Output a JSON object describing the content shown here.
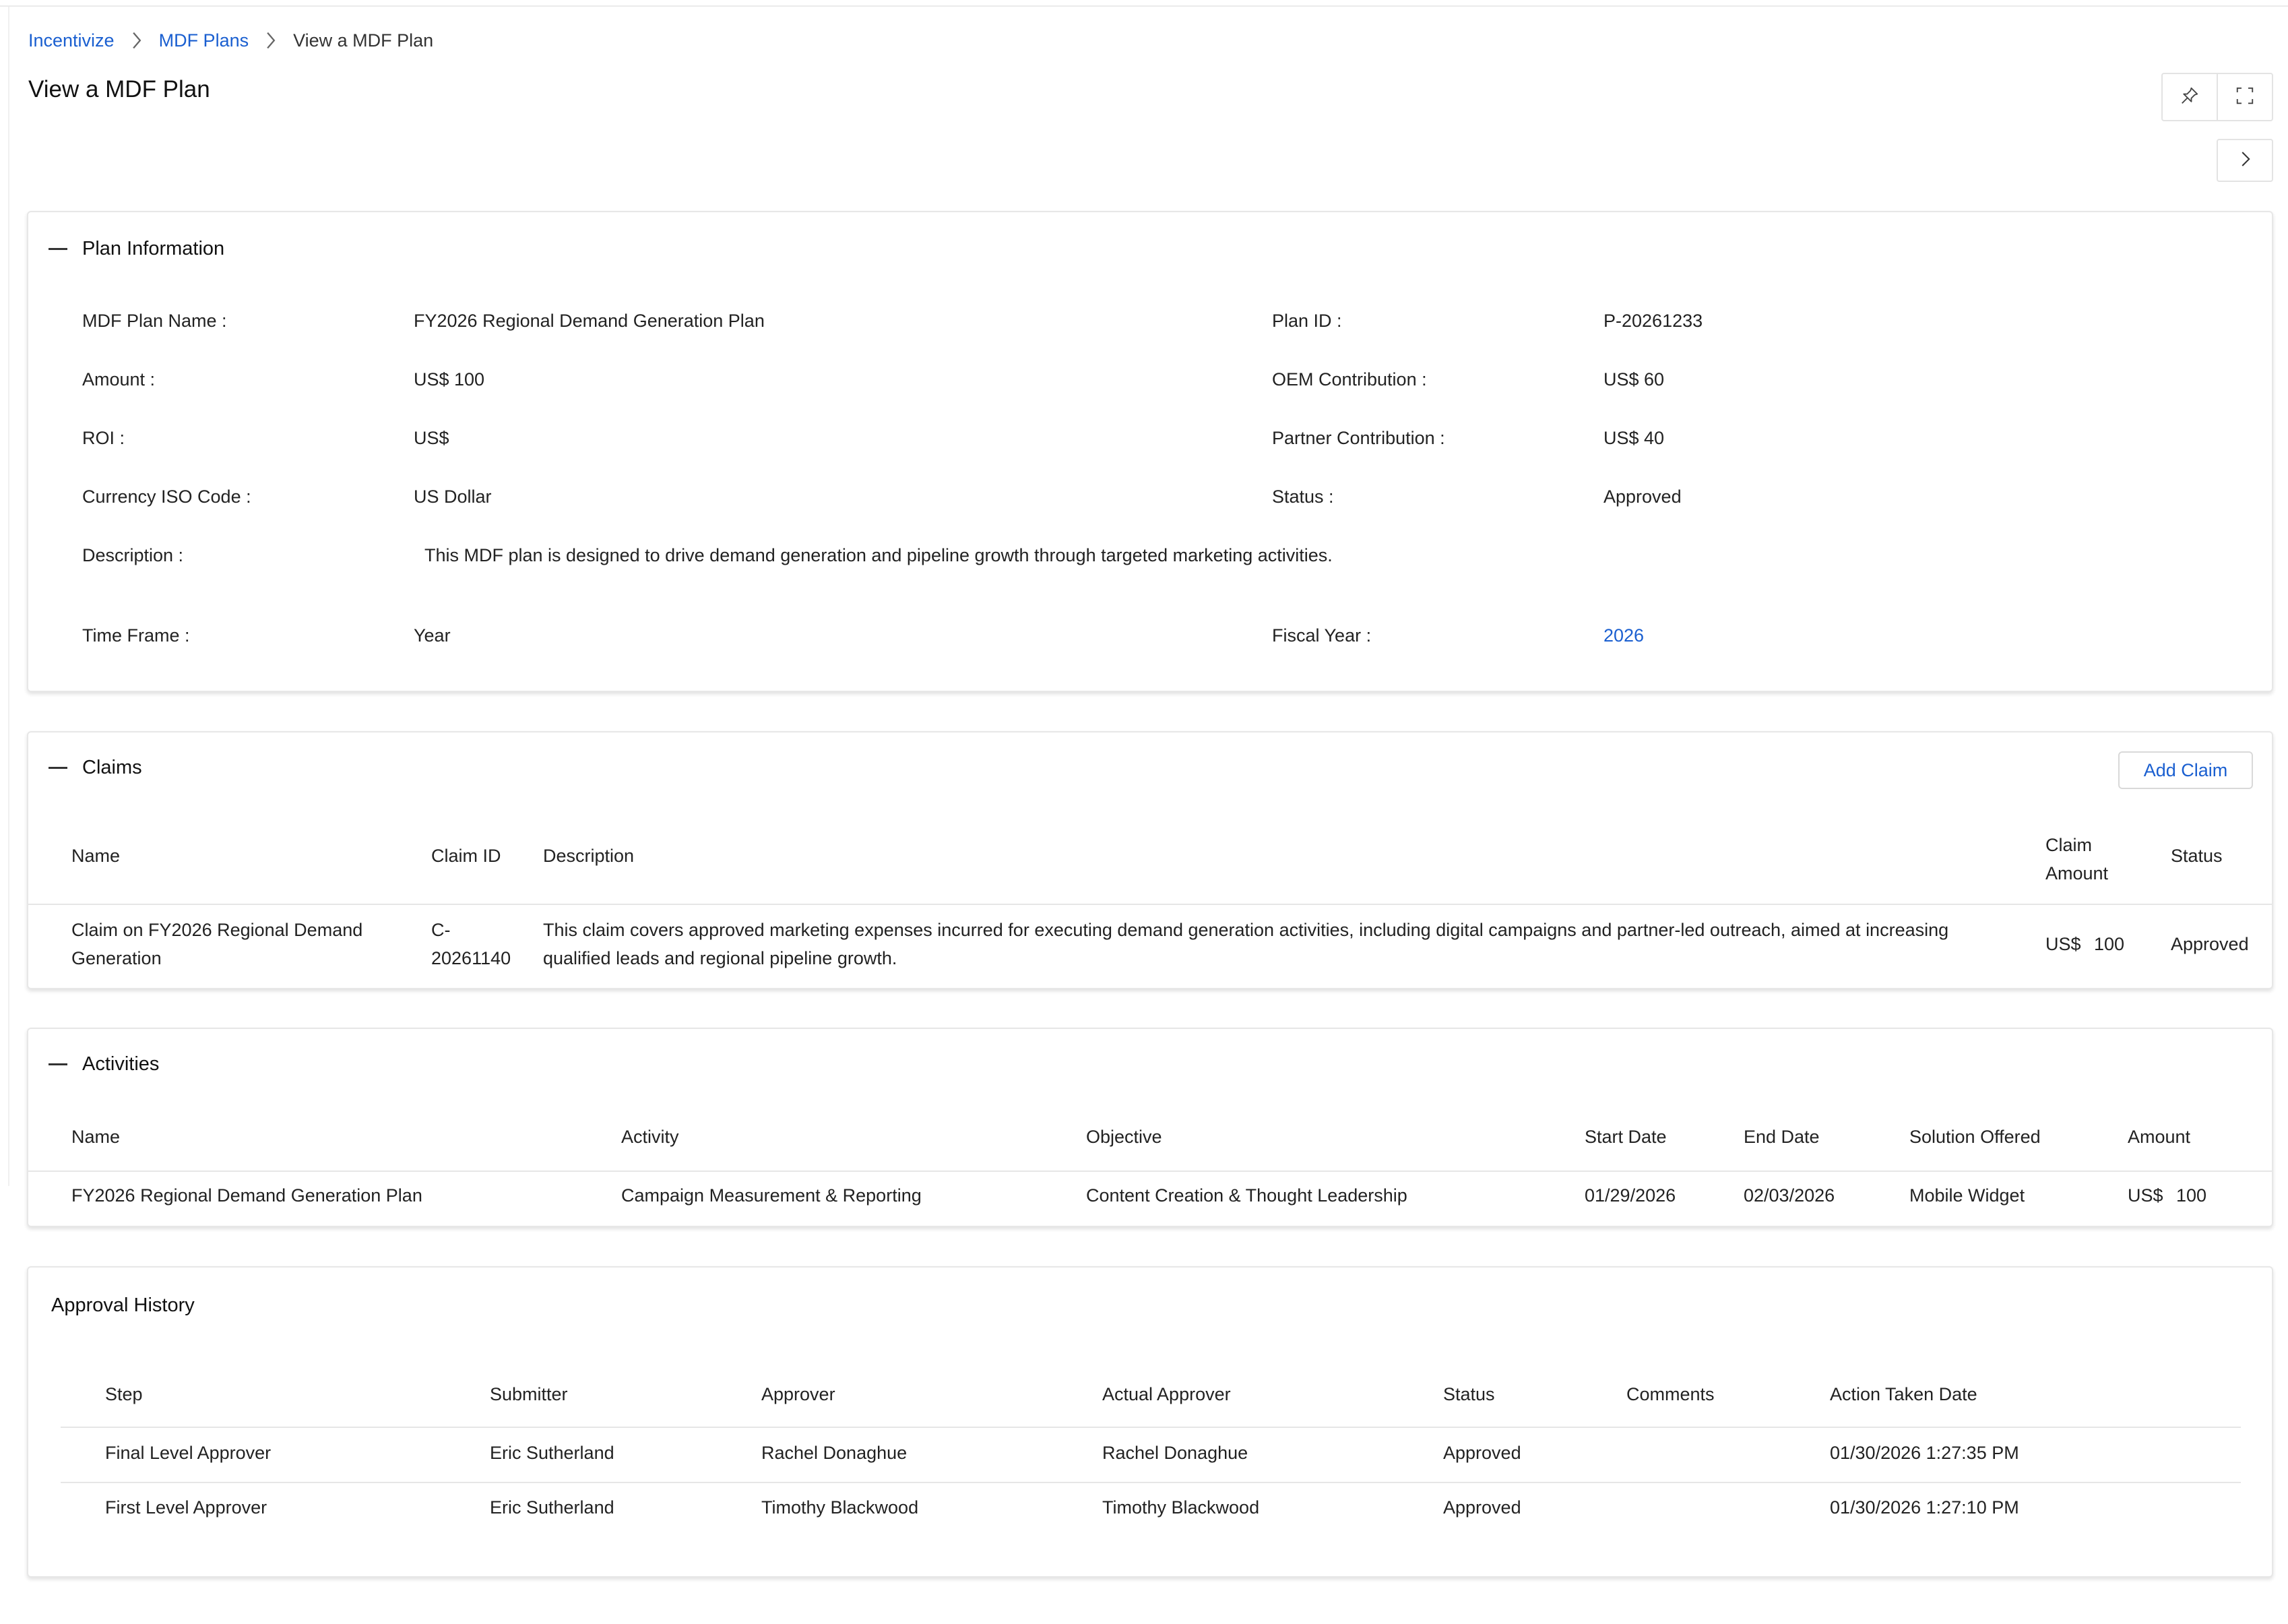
{
  "breadcrumb": [
    "Incentivize",
    "MDF Plans",
    "View a MDF Plan"
  ],
  "page_title": "View a MDF Plan",
  "icons": {
    "pin": "pin-icon",
    "fullscreen": "fullscreen-icon",
    "next": "chevron-right-icon"
  },
  "colors": {
    "link": "#1a5fd0",
    "border": "#e7e7e7"
  },
  "plan_info": {
    "title": "Plan Information",
    "name_label": "MDF Plan Name :",
    "name_value": "FY2026 Regional Demand Generation Plan",
    "id_label": "Plan ID :",
    "id_value": "P-20261233",
    "amount_label": "Amount :",
    "amount_value": "US$ 100",
    "oem_label": "OEM Contribution :",
    "oem_value": "US$ 60",
    "roi_label": "ROI :",
    "roi_value": "US$",
    "partner_label": "Partner Contribution :",
    "partner_value": "US$ 40",
    "currency_label": "Currency ISO Code :",
    "currency_value": "US Dollar",
    "status_label": "Status :",
    "status_value": "Approved",
    "desc_label": "Description :",
    "desc_value": "This MDF plan is designed to drive demand generation and pipeline growth through targeted marketing activities.",
    "timeframe_label": "Time Frame :",
    "timeframe_value": "Year",
    "fiscal_label": "Fiscal Year :",
    "fiscal_value": "2026"
  },
  "claims": {
    "title": "Claims",
    "add_button": "Add Claim",
    "columns": {
      "name": "Name",
      "claim_id": "Claim ID",
      "description": "Description",
      "claim_amount_1": "Claim",
      "claim_amount_2": "Amount",
      "status": "Status"
    },
    "rows": [
      {
        "name_1": "Claim on FY2026 Regional Demand",
        "name_2": "Generation",
        "id_1": "C-",
        "id_2": "20261140",
        "desc_1": "This claim covers approved marketing expenses incurred for executing demand generation activities, including digital campaigns and partner-led outreach, aimed at increasing",
        "desc_2": "qualified leads and regional pipeline growth.",
        "currency": "US$",
        "amount": "100",
        "status": "Approved"
      }
    ]
  },
  "activities": {
    "title": "Activities",
    "columns": {
      "name": "Name",
      "activity": "Activity",
      "objective": "Objective",
      "start": "Start Date",
      "end": "End Date",
      "solution": "Solution Offered",
      "amount": "Amount"
    },
    "rows": [
      {
        "name": "FY2026 Regional Demand Generation Plan",
        "activity": "Campaign Measurement & Reporting",
        "objective": "Content Creation & Thought Leadership",
        "start": "01/29/2026",
        "end": "02/03/2026",
        "solution": "Mobile Widget",
        "currency": "US$",
        "amount": "100"
      }
    ]
  },
  "approval": {
    "title": "Approval History",
    "columns": {
      "step": "Step",
      "submitter": "Submitter",
      "approver": "Approver",
      "actual": "Actual Approver",
      "status": "Status",
      "comments": "Comments",
      "date": "Action Taken Date"
    },
    "rows": [
      {
        "step": "Final Level Approver",
        "submitter": "Eric Sutherland",
        "approver": "Rachel Donaghue",
        "actual": "Rachel Donaghue",
        "status": "Approved",
        "comments": "",
        "date": "01/30/2026 1:27:35 PM"
      },
      {
        "step": "First Level Approver",
        "submitter": "Eric Sutherland",
        "approver": "Timothy Blackwood",
        "actual": "Timothy Blackwood",
        "status": "Approved",
        "comments": "",
        "date": "01/30/2026 1:27:10 PM"
      }
    ]
  }
}
